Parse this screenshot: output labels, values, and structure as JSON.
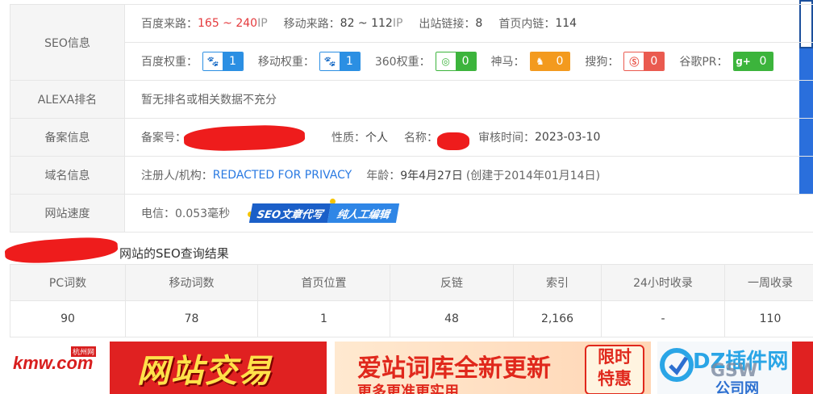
{
  "seo_info": {
    "label": "SEO信息",
    "baidu_traffic_label": "百度来路：",
    "baidu_traffic_value": "165 ~ 240",
    "baidu_traffic_unit": " IP",
    "mobile_traffic_label": "移动来路：",
    "mobile_traffic_value": "82 ~ 112",
    "mobile_traffic_unit": " IP",
    "outbound_label": "出站链接：",
    "outbound_value": "8",
    "inner_links_label": "首页内链：",
    "inner_links_value": "114",
    "baidu_weight_label": "百度权重：",
    "baidu_weight_value": "1",
    "mobile_weight_label": "移动权重：",
    "mobile_weight_value": "1",
    "weight_360_label": "360权重：",
    "weight_360_value": "0",
    "shenma_label": "神马：",
    "shenma_value": "0",
    "sogou_label": "搜狗：",
    "sogou_value": "0",
    "google_label": "谷歌PR：",
    "google_value": "0",
    "badge_colors": {
      "baidu": "#2b8fe3",
      "360": "#3cb43c",
      "shenma": "#f39a1e",
      "sogou": "#ea5a4f",
      "google": "#3cb43c"
    }
  },
  "alexa": {
    "label": "ALEXA排名",
    "value": "暂无排名或相关数据不充分"
  },
  "icp": {
    "label": "备案信息",
    "number_label": "备案号：",
    "nature_label": "性质：",
    "nature_value": "个人",
    "name_label": "名称：",
    "audit_label": "审核时间：",
    "audit_value": "2023-03-10"
  },
  "domain": {
    "label": "域名信息",
    "registrant_label": "注册人/机构：",
    "registrant_value": "REDACTED FOR PRIVACY",
    "age_label": "年龄：",
    "age_value": "9年4月27日",
    "created_value": "(创建于2014年01月14日)"
  },
  "speed": {
    "label": "网站速度",
    "telecom_label": "电信：",
    "telecom_value": "0.053毫秒",
    "banner_a": "SEO文章代写",
    "banner_b": "纯人工编辑"
  },
  "results": {
    "title": "网站的SEO查询结果",
    "headers": [
      "PC词数",
      "移动词数",
      "首页位置",
      "反链",
      "索引",
      "24小时收录",
      "一周收录"
    ],
    "values": [
      "90",
      "78",
      "1",
      "48",
      "2,166",
      "-",
      "110"
    ]
  },
  "ads": {
    "ad1_logo": "kmw.com",
    "ad1_tag": "杭州网",
    "ad1_text": "网站交易",
    "ad2_title": "爱站词库全新更新",
    "ad2_sub": "更多更准更实用",
    "ad2_box_line1": "限时",
    "ad2_box_line2": "特惠",
    "ad3_text": "DZ插件网",
    "ad3_gsw": "GSW",
    "ad3_company": "公司网"
  }
}
